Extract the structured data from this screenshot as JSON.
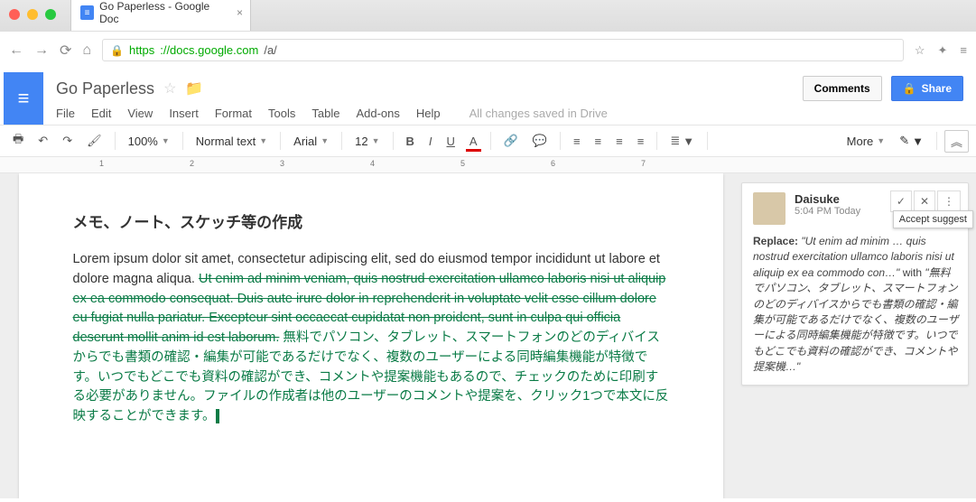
{
  "browser": {
    "tab_title": "Go Paperless - Google Doc",
    "url_secure": "https",
    "url_host": "://docs.google.com",
    "url_path": "/a/"
  },
  "doc": {
    "title": "Go Paperless",
    "menus": [
      "File",
      "Edit",
      "View",
      "Insert",
      "Format",
      "Tools",
      "Table",
      "Add-ons",
      "Help"
    ],
    "save_status": "All changes saved in Drive",
    "comments_label": "Comments",
    "share_label": "Share"
  },
  "toolbar": {
    "zoom": "100%",
    "style": "Normal text",
    "font": "Arial",
    "size": "12",
    "more": "More"
  },
  "ruler": [
    "1",
    "2",
    "3",
    "4",
    "5",
    "6",
    "7"
  ],
  "content": {
    "heading": "メモ、ノート、スケッチ等の作成",
    "plain1": "Lorem ipsum dolor sit amet, consectetur adipiscing elit, sed do eiusmod tempor incididunt ut labore et dolore magna aliqua. ",
    "strike": "Ut enim ad minim veniam, quis nostrud exercitation ullamco laboris nisi ut aliquip ex ea commodo consequat. Duis aute irure dolor in reprehenderit in voluptate velit esse cillum dolore eu fugiat nulla pariatur. Excepteur sint occaecat cupidatat non proident, sunt in culpa qui officia deserunt mollit anim id est laborum.",
    "insert": " 無料でパソコン、タブレット、スマートフォンのどのディバイスからでも書類の確認・編集が可能であるだけでなく、複数のユーザーによる同時編集機能が特徴です。いつでもどこでも資料の確認ができ、コメントや提案機能もあるので、チェックのために印刷する必要がありません。ファイルの作成者は他のユーザーのコメントや提案を、クリック1つで本文に反映することができます。"
  },
  "suggestion": {
    "user": "Daisuke",
    "time": "5:04 PM Today",
    "action_label": "Replace:",
    "from": "\"Ut enim ad minim … quis nostrud exercitation ullamco laboris nisi ut aliquip ex ea commodo con…\"",
    "with_label": " with ",
    "to": "\"無料でパソコン、タブレット、スマートフォンのどのディバイスからでも書類の確認・編集が可能であるだけでなく、複数のユーザーによる同時編集機能が特徴です。いつでもどこでも資料の確認ができ、コメントや提案機…\"",
    "tooltip": "Accept suggest"
  }
}
